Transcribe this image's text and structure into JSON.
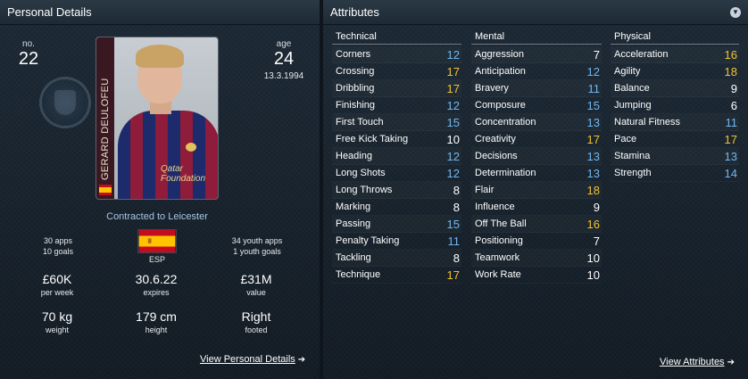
{
  "colors": {
    "value_high": "#f2c230",
    "value_mid": "#6fb7f2",
    "value_low": "#ffffff",
    "link": "#a8c6e6"
  },
  "personal": {
    "title": "Personal Details",
    "no_label": "no.",
    "no_value": "22",
    "age_label": "age",
    "age_value": "24",
    "dob": "13.3.1994",
    "card_name": "GERARD DEULOFEU",
    "contract": "Contracted to Leicester",
    "nation_code": "ESP",
    "apps": "30 apps",
    "goals": "10 goals",
    "youth_apps": "34 youth apps",
    "youth_goals": "1 youth goals",
    "wage_value": "£60K",
    "wage_label": "per week",
    "expires_value": "30.6.22",
    "expires_label": "expires",
    "value_value": "£31M",
    "value_label": "value",
    "weight_value": "70 kg",
    "weight_label": "weight",
    "height_value": "179 cm",
    "height_label": "height",
    "footed_value": "Right",
    "footed_label": "footed",
    "view_link": "View Personal Details",
    "photo_sponsor": "Qatar Foundation"
  },
  "attributes": {
    "title": "Attributes",
    "view_link": "View Attributes",
    "technical": {
      "header": "Technical",
      "items": [
        {
          "name": "Corners",
          "value": 12
        },
        {
          "name": "Crossing",
          "value": 17
        },
        {
          "name": "Dribbling",
          "value": 17
        },
        {
          "name": "Finishing",
          "value": 12
        },
        {
          "name": "First Touch",
          "value": 15
        },
        {
          "name": "Free Kick Taking",
          "value": 10
        },
        {
          "name": "Heading",
          "value": 12
        },
        {
          "name": "Long Shots",
          "value": 12
        },
        {
          "name": "Long Throws",
          "value": 8
        },
        {
          "name": "Marking",
          "value": 8
        },
        {
          "name": "Passing",
          "value": 15
        },
        {
          "name": "Penalty Taking",
          "value": 11
        },
        {
          "name": "Tackling",
          "value": 8
        },
        {
          "name": "Technique",
          "value": 17
        }
      ]
    },
    "mental": {
      "header": "Mental",
      "items": [
        {
          "name": "Aggression",
          "value": 7
        },
        {
          "name": "Anticipation",
          "value": 12
        },
        {
          "name": "Bravery",
          "value": 11
        },
        {
          "name": "Composure",
          "value": 15
        },
        {
          "name": "Concentration",
          "value": 13
        },
        {
          "name": "Creativity",
          "value": 17
        },
        {
          "name": "Decisions",
          "value": 13
        },
        {
          "name": "Determination",
          "value": 13
        },
        {
          "name": "Flair",
          "value": 18
        },
        {
          "name": "Influence",
          "value": 9
        },
        {
          "name": "Off The Ball",
          "value": 16
        },
        {
          "name": "Positioning",
          "value": 7
        },
        {
          "name": "Teamwork",
          "value": 10
        },
        {
          "name": "Work Rate",
          "value": 10
        }
      ]
    },
    "physical": {
      "header": "Physical",
      "items": [
        {
          "name": "Acceleration",
          "value": 16
        },
        {
          "name": "Agility",
          "value": 18
        },
        {
          "name": "Balance",
          "value": 9
        },
        {
          "name": "Jumping",
          "value": 6
        },
        {
          "name": "Natural Fitness",
          "value": 11
        },
        {
          "name": "Pace",
          "value": 17
        },
        {
          "name": "Stamina",
          "value": 13
        },
        {
          "name": "Strength",
          "value": 14
        }
      ]
    }
  }
}
